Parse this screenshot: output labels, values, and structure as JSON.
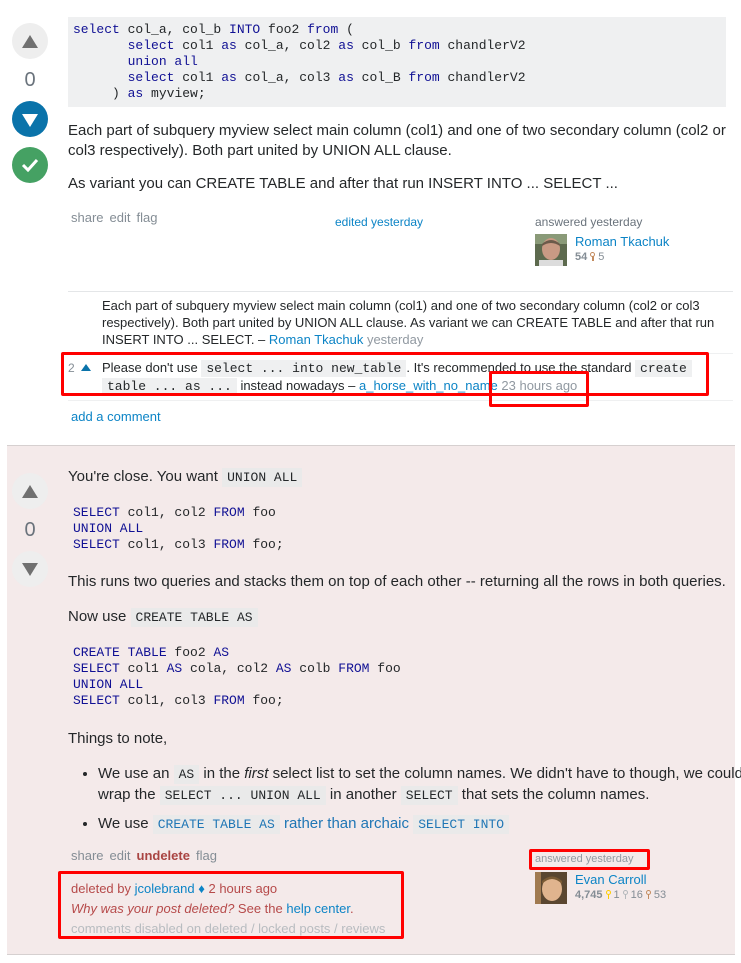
{
  "answer1": {
    "vote_count": "0",
    "code": {
      "line1": [
        "select",
        " col_a, col_b ",
        "INTO",
        " foo2 ",
        "from",
        " ("
      ],
      "line2": [
        "select",
        " col1 ",
        "as",
        " col_a, col2 ",
        "as",
        " col_b ",
        "from",
        " chandlerV2"
      ],
      "line3": [
        "union all"
      ],
      "line4": [
        "select",
        " col1 ",
        "as",
        " col_a, col3 ",
        "as",
        " col_B ",
        "from",
        " chandlerV2"
      ],
      "line5": [
        ") ",
        "as",
        " myview;"
      ]
    },
    "paragraph1": "Each part of subquery myview select main column (col1) and one of two secondary column (col2 or col3 respectively). Both part united by UNION ALL clause.",
    "paragraph2": "As variant you can CREATE TABLE and after that run INSERT INTO ... SELECT ...",
    "menu": {
      "share": "share",
      "edit": "edit",
      "flag": "flag"
    },
    "edited": "edited yesterday",
    "answered": "answered yesterday",
    "user": {
      "name": "Roman Tkachuk",
      "reputation": "54",
      "bronze": "5"
    },
    "comments": [
      {
        "score": "",
        "text": "Each part of subquery myview select main column (col1) and one of two secondary column (col2 or col3 respectively). Both part united by UNION ALL clause. As variant we can CREATE TABLE and after that run INSERT INTO ... SELECT.",
        "dash": " – ",
        "author": "Roman Tkachuk",
        "time": "yesterday"
      },
      {
        "score": "2",
        "text_a": "Please don't use ",
        "code_a": "select ... into new_table",
        "text_b": ". It's recommended to use the standard ",
        "code_b1": "create",
        "code_b2": "table ... as ...",
        "text_c": " instead nowadays",
        "dash": " – ",
        "author": "a_horse_with_no_name",
        "time": "23 hours ago"
      }
    ],
    "add_comment": "add a comment"
  },
  "answer2": {
    "vote_count": "0",
    "intro_text": "You're close. You want ",
    "intro_code": "UNION ALL",
    "code1": {
      "line1": [
        "SELECT",
        " col1, col2 ",
        "FROM",
        " foo"
      ],
      "line2": [
        "UNION ALL"
      ],
      "line3": [
        "SELECT",
        " col1, col3 ",
        "FROM",
        " foo;"
      ]
    },
    "paragraph1": "This runs two queries and stacks them on top of each other -- returning all the rows in both queries.",
    "now_use_text": "Now use ",
    "now_use_code": "CREATE TABLE AS",
    "code2": {
      "line1": [
        "CREATE TABLE",
        " foo2 ",
        "AS"
      ],
      "line2": [
        "SELECT",
        " col1 ",
        "AS",
        " cola, col2 ",
        "AS",
        " colb ",
        "FROM",
        " foo"
      ],
      "line3": [
        "UNION ALL"
      ],
      "line4": [
        "SELECT",
        " col1, col3 ",
        "FROM",
        " foo;"
      ]
    },
    "things_to_note": "Things to note,",
    "notes": [
      {
        "t1": "We use an ",
        "c1": "AS",
        "t2": " in the ",
        "em": "first",
        "t3": " select list to set the column names. We didn't have to though, we could wrap the ",
        "c2": "SELECT ... UNION ALL",
        "t4": " in another ",
        "c3": "SELECT",
        "t5": " that sets the column names."
      },
      {
        "t1": "We use ",
        "c1": "CREATE TABLE AS",
        "t2": " rather than archaic ",
        "c2": "SELECT INTO"
      }
    ],
    "menu": {
      "share": "share",
      "edit": "edit",
      "undelete": "undelete",
      "flag": "flag"
    },
    "deleted_by": "deleted by ",
    "deleted_user": "jcolebrand",
    "mod_diamond": "♦",
    "deleted_time": " 2 hours ago",
    "why_deleted": "Why was your post deleted?",
    "see_the": " See the ",
    "help_center": "help center",
    "period": ".",
    "comments_disabled": "comments disabled on deleted / locked posts / reviews",
    "answered": "answered yesterday",
    "user": {
      "name": "Evan Carroll",
      "reputation": "4,745",
      "gold": "1",
      "silver": "16",
      "bronze": "53"
    }
  }
}
